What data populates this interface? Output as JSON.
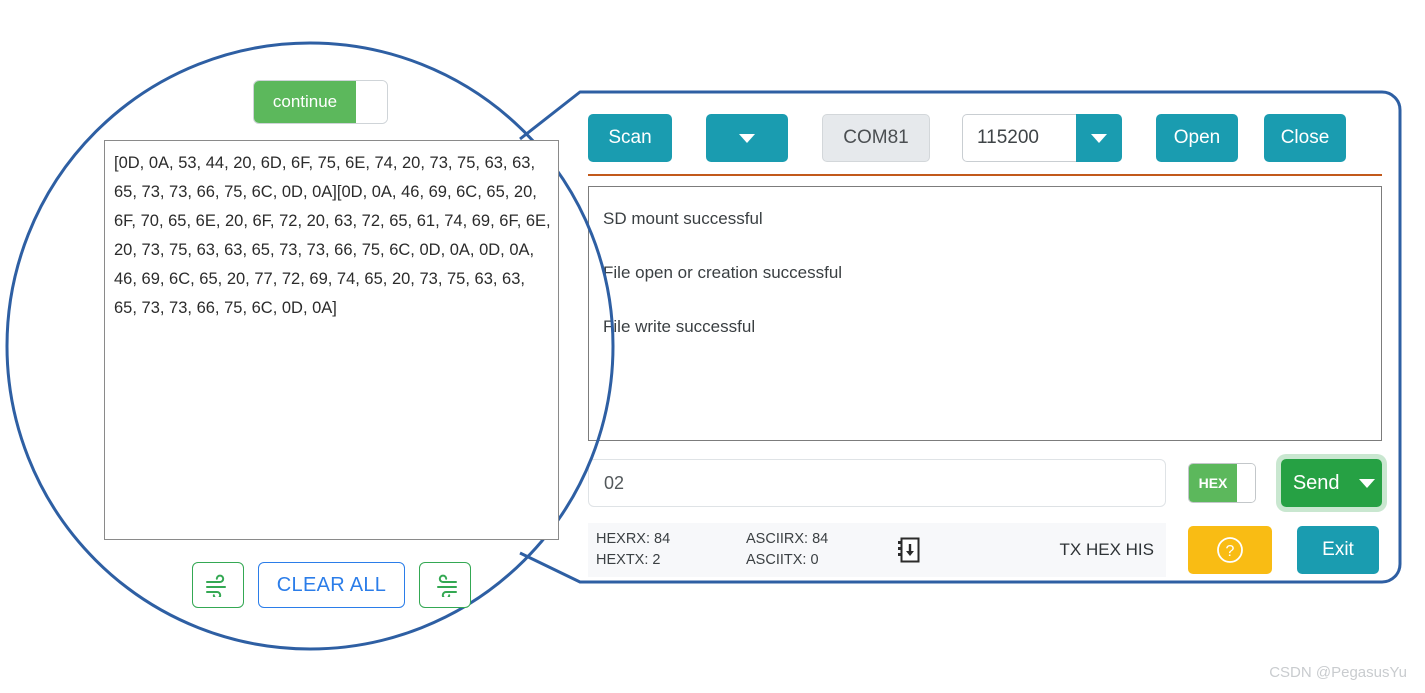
{
  "magnifier": {
    "continue_toggle": {
      "label": "continue",
      "state": "on"
    },
    "hex_log": "[0D, 0A, 53, 44, 20, 6D, 6F, 75, 6E, 74, 20, 73, 75, 63, 63, 65, 73, 73, 66, 75, 6C, 0D, 0A][0D, 0A, 46, 69, 6C, 65, 20, 6F, 70, 65, 6E, 20, 6F, 72, 20, 63, 72, 65, 61, 74, 69, 6F, 6E, 20, 73, 75, 63, 63, 65, 73, 73, 66, 75, 6C, 0D, 0A, 0D, 0A, 46, 69, 6C, 65, 20, 77, 72, 69, 74, 65, 20, 73, 75, 63, 63, 65, 73, 73, 66, 75, 6C, 0D, 0A]",
    "buttons": {
      "wind_left_icon": "wind-icon",
      "clear_all_label": "CLEAR ALL",
      "wind_right_icon": "wind-reverse-icon"
    }
  },
  "toolbar": {
    "scan_label": "Scan",
    "scan_dropdown_icon": "chevron-down-icon",
    "port_value": "COM81",
    "baud_value": "115200",
    "baud_dropdown_icon": "chevron-down-icon",
    "open_label": "Open",
    "close_label": "Close"
  },
  "receive": {
    "lines": [
      "SD mount successful",
      "File open or creation successful",
      "File write successful"
    ]
  },
  "send": {
    "input_value": "02",
    "input_placeholder": "",
    "hex_toggle": {
      "label": "HEX",
      "state": "on"
    },
    "send_label": "Send",
    "send_dropdown_icon": "chevron-down-icon"
  },
  "status": {
    "hexrx_label": "HEXRX:",
    "hexrx_value": "84",
    "hextx_label": "HEXTX:",
    "hextx_value": "2",
    "asciirx_label": "ASCIIRX:",
    "asciirx_value": "84",
    "asciitx_label": "ASCIITX:",
    "asciitx_value": "0",
    "save_icon": "save-to-file-icon",
    "tx_hex_his_label": "TX HEX HIS",
    "help_icon": "question-circle-icon",
    "exit_label": "Exit"
  },
  "watermark": "CSDN @PegasusYu",
  "colors": {
    "accent_teal": "#1a9cb0",
    "accent_green": "#26a144",
    "toggle_green": "#5cb85c",
    "amber": "#f9bc14",
    "callout_blue": "#2e5fa3",
    "divider_orange": "#c2591b",
    "link_blue": "#2b7de9",
    "icon_green": "#34a853"
  }
}
